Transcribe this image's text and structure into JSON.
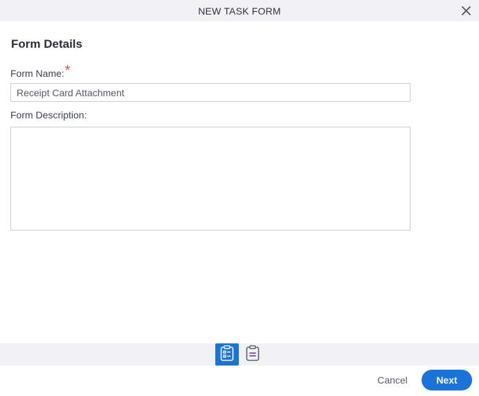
{
  "dialog": {
    "title": "NEW TASK FORM"
  },
  "section": {
    "title": "Form Details"
  },
  "form_name": {
    "label": "Form Name:",
    "required_marker": "*",
    "value": "Receipt Card Attachment"
  },
  "form_description": {
    "label": "Form Description:",
    "value": ""
  },
  "steps": [
    {
      "icon": "form-details-icon",
      "active": true
    },
    {
      "icon": "form-list-icon",
      "active": false
    }
  ],
  "footer": {
    "cancel_label": "Cancel",
    "next_label": "Next"
  },
  "colors": {
    "accent": "#1a73d9",
    "required": "#e5483f",
    "header_bg": "#f2f2f5"
  }
}
